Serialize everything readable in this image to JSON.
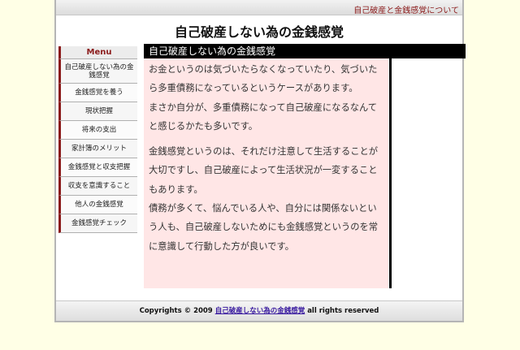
{
  "header": {
    "top_link": "自己破産と金銭感覚について",
    "site_title": "自己破産しない為の金銭感覚"
  },
  "sidebar": {
    "menu_label": "Menu",
    "items": [
      {
        "label": "自己破産しない為の金銭感覚"
      },
      {
        "label": "金銭感覚を養う"
      },
      {
        "label": "現状把握"
      },
      {
        "label": "将来の支出"
      },
      {
        "label": "家計簿のメリット"
      },
      {
        "label": "金銭感覚と収支把握"
      },
      {
        "label": "収支を意識すること"
      },
      {
        "label": "他人の金銭感覚"
      },
      {
        "label": "金銭感覚チェック"
      }
    ]
  },
  "main": {
    "heading": "自己破産しない為の金銭感覚",
    "paragraphs": [
      "お金というのは気づいたらなくなっていたり、気づいたら多重債務になっているというケースがあります。",
      "まさか自分が、多重債務になって自己破産になるなんてと感じるかたも多いです。",
      "金銭感覚というのは、それだけ注意して生活することが大切ですし、自己破産によって生活状況が一変することもあります。",
      "債務が多くて、悩んでいる人や、自分には関係ないという人も、自己破産しないためにも金銭感覚というのを常に意識して行動した方が良いです。"
    ]
  },
  "footer": {
    "prefix": "Copyrights © 2009",
    "link_text": "自己破産しない為の金銭感覚",
    "suffix": "all rights reserved"
  }
}
